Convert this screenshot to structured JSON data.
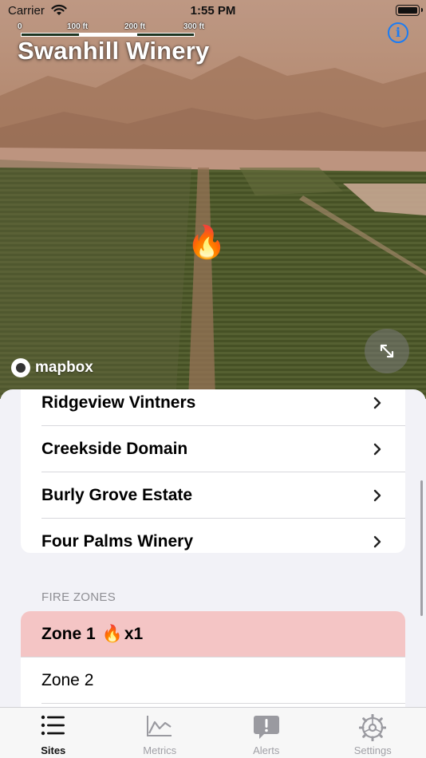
{
  "status_bar": {
    "carrier": "Carrier",
    "time": "1:55 PM"
  },
  "map": {
    "title": "Swanhill Winery",
    "scale_labels": [
      "0",
      "100 ft",
      "200 ft",
      "300 ft"
    ],
    "attribution": "mapbox",
    "marker_icon": "fire-icon"
  },
  "sites": {
    "items": [
      {
        "label": "Ridgeview Vintners"
      },
      {
        "label": "Creekside Domain"
      },
      {
        "label": "Burly Grove Estate"
      },
      {
        "label": "Four Palms Winery"
      }
    ]
  },
  "fire_zones": {
    "header": "FIRE ZONES",
    "items": [
      {
        "label": "Zone 1",
        "count": "x1",
        "alert": true
      },
      {
        "label": "Zone 2",
        "alert": false
      }
    ],
    "alert_color": "#f4c5c5"
  },
  "tab_bar": {
    "tabs": [
      {
        "label": "Sites",
        "icon": "list-icon",
        "active": true
      },
      {
        "label": "Metrics",
        "icon": "chart-icon",
        "active": false
      },
      {
        "label": "Alerts",
        "icon": "alert-bubble-icon",
        "active": false
      },
      {
        "label": "Settings",
        "icon": "gear-icon",
        "active": false
      }
    ]
  },
  "colors": {
    "accent": "#1a7cf5"
  }
}
